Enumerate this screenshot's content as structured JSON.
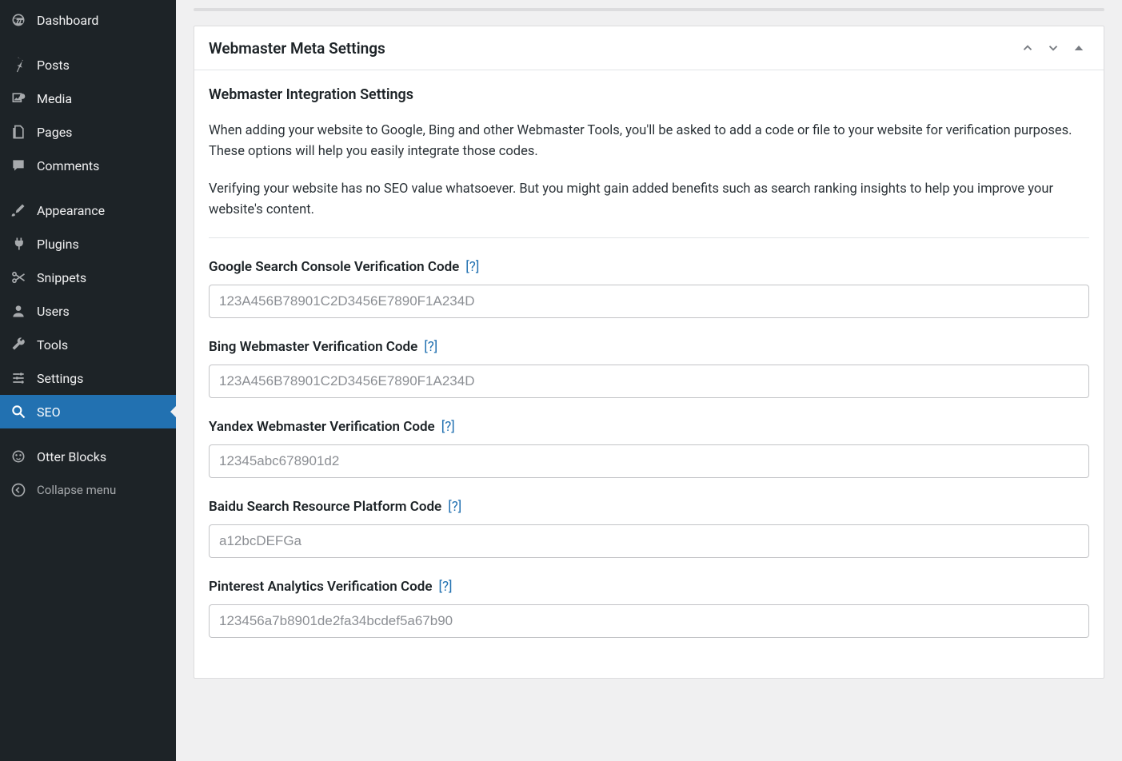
{
  "sidebar": {
    "items": [
      {
        "label": "Dashboard"
      },
      {
        "label": "Posts"
      },
      {
        "label": "Media"
      },
      {
        "label": "Pages"
      },
      {
        "label": "Comments"
      },
      {
        "label": "Appearance"
      },
      {
        "label": "Plugins"
      },
      {
        "label": "Snippets"
      },
      {
        "label": "Users"
      },
      {
        "label": "Tools"
      },
      {
        "label": "Settings"
      },
      {
        "label": "SEO"
      },
      {
        "label": "Otter Blocks"
      }
    ],
    "collapse_label": "Collapse menu"
  },
  "panel": {
    "title": "Webmaster Meta Settings",
    "subtitle": "Webmaster Integration Settings",
    "desc1": "When adding your website to Google, Bing and other Webmaster Tools, you'll be asked to add a code or file to your website for verification purposes. These options will help you easily integrate those codes.",
    "desc2": "Verifying your website has no SEO value whatsoever. But you might gain added benefits such as search ranking insights to help you improve your website's content.",
    "help": "[?]",
    "fields": [
      {
        "label": "Google Search Console Verification Code",
        "placeholder": "123A456B78901C2D3456E7890F1A234D",
        "value": ""
      },
      {
        "label": "Bing Webmaster Verification Code",
        "placeholder": "123A456B78901C2D3456E7890F1A234D",
        "value": ""
      },
      {
        "label": "Yandex Webmaster Verification Code",
        "placeholder": "12345abc678901d2",
        "value": ""
      },
      {
        "label": "Baidu Search Resource Platform Code",
        "placeholder": "a12bcDEFGa",
        "value": ""
      },
      {
        "label": "Pinterest Analytics Verification Code",
        "placeholder": "123456a7b8901de2fa34bcdef5a67b90",
        "value": ""
      }
    ]
  }
}
